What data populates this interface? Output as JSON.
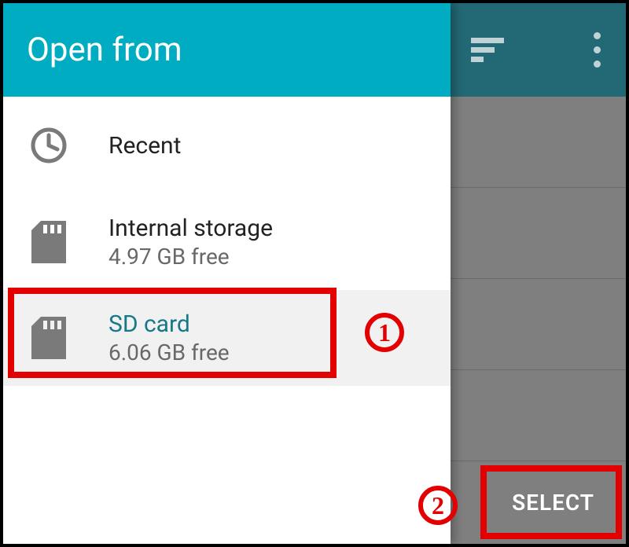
{
  "drawer": {
    "title": "Open from",
    "items": [
      {
        "label": "Recent",
        "sub": ""
      },
      {
        "label": "Internal storage",
        "sub": "4.97 GB free"
      },
      {
        "label": "SD card",
        "sub": "6.06 GB free"
      }
    ]
  },
  "underlying": {
    "select_label": "SELECT"
  },
  "annotations": {
    "n1": "1",
    "n2": "2"
  },
  "colors": {
    "accent": "#00acc1",
    "annotation": "#e30000"
  }
}
